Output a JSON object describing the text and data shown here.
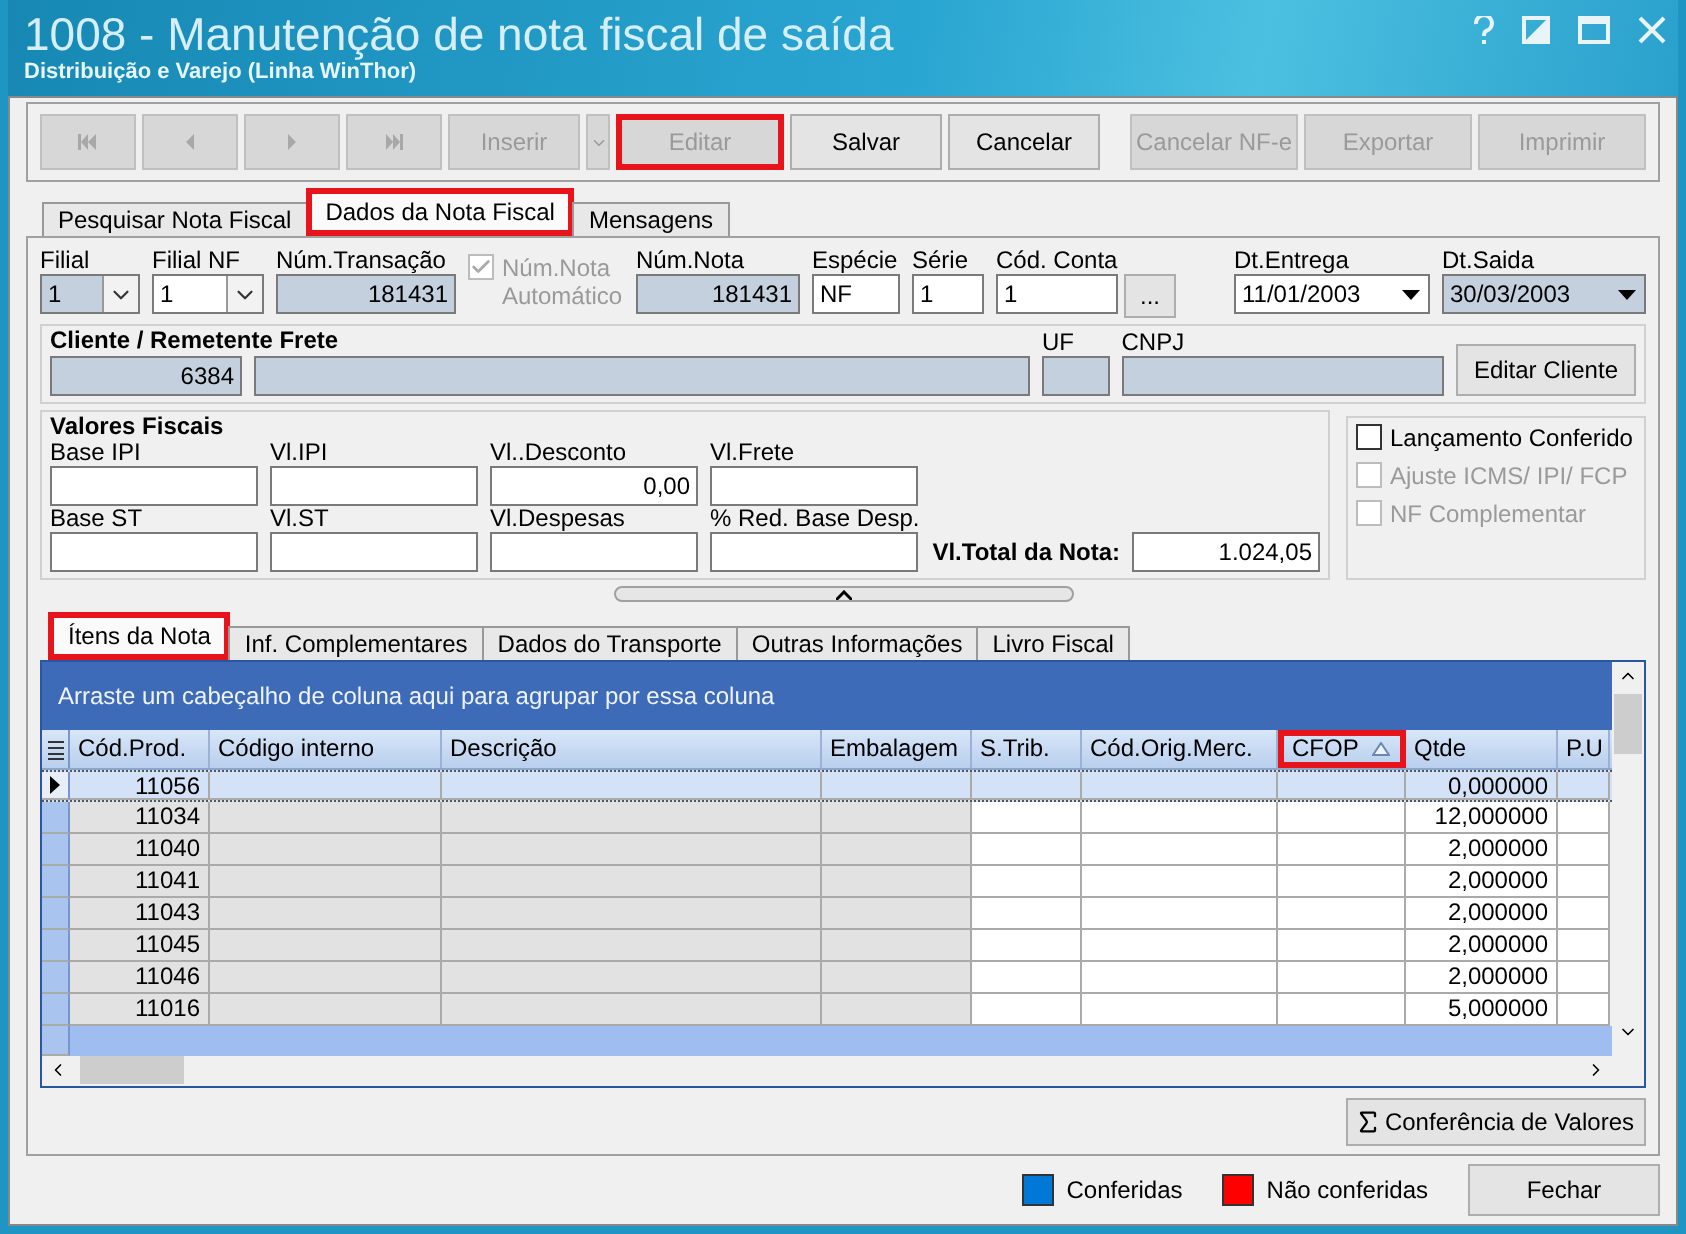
{
  "window": {
    "title": "1008 - Manutenção de nota fiscal de saída",
    "subtitle": "Distribuição e Varejo (Linha WinThor)"
  },
  "toolbar": {
    "buttons": [
      {
        "kind": "first",
        "disabled": true,
        "highlighted": false
      },
      {
        "kind": "prev",
        "disabled": true,
        "highlighted": false
      },
      {
        "kind": "next",
        "disabled": true,
        "highlighted": false
      },
      {
        "kind": "last",
        "disabled": true,
        "highlighted": false
      },
      {
        "kind": "dropdown",
        "label": "Inserir",
        "disabled": true,
        "highlighted": false
      },
      {
        "kind": "text",
        "label": "Editar",
        "disabled": true,
        "highlighted": true
      },
      {
        "kind": "text",
        "label": "Salvar",
        "disabled": false,
        "highlighted": false
      },
      {
        "kind": "text",
        "label": "Cancelar",
        "disabled": false,
        "highlighted": false
      },
      {
        "kind": "text",
        "label": "Cancelar NF-e",
        "disabled": true,
        "highlighted": false
      },
      {
        "kind": "text",
        "label": "Exportar",
        "disabled": true,
        "highlighted": false
      },
      {
        "kind": "text",
        "label": "Imprimir",
        "disabled": true,
        "highlighted": false
      }
    ]
  },
  "tabs": [
    {
      "label": "Pesquisar Nota Fiscal",
      "selected": false,
      "highlighted": false
    },
    {
      "label": "Dados da Nota Fiscal",
      "selected": true,
      "highlighted": true
    },
    {
      "label": "Mensagens",
      "selected": false,
      "highlighted": false
    }
  ],
  "header_fields": [
    {
      "kind": "combo",
      "label": "Filial",
      "value": "1",
      "readonly": true
    },
    {
      "kind": "combo",
      "label": "Filial NF",
      "value": "1",
      "readonly": false
    },
    {
      "kind": "text",
      "label": "Núm.Transação",
      "value": "181431",
      "readonly": true
    },
    {
      "kind": "check",
      "label": "Núm.Nota Automático",
      "checked": true,
      "disabled": true
    },
    {
      "kind": "text",
      "label": "Núm.Nota",
      "value": "181431",
      "readonly": true
    },
    {
      "kind": "text",
      "label": "Espécie",
      "value": "NF",
      "readonly": false
    },
    {
      "kind": "text",
      "label": "Série",
      "value": "1",
      "readonly": false
    },
    {
      "kind": "lookup",
      "label": "Cód. Conta",
      "value": "1",
      "button": "...",
      "readonly": false
    },
    {
      "kind": "date",
      "label": "Dt.Entrega",
      "value": "11/01/2003",
      "readonly": false
    },
    {
      "kind": "date",
      "label": "Dt.Saida",
      "value": "30/03/2003",
      "readonly": true
    }
  ],
  "cliente": {
    "title": "Cliente / Remetente Frete",
    "codigo": "6384",
    "uf_label": "UF",
    "cnpj_label": "CNPJ",
    "button": "Editar Cliente"
  },
  "valores": {
    "title": "Valores Fiscais",
    "fields": [
      {
        "label": "Base IPI"
      },
      {
        "label": "Vl.IPI"
      },
      {
        "label": "Vl..Desconto",
        "value": "0,00"
      },
      {
        "label": "Vl.Frete"
      },
      {
        "label": "Base ST"
      },
      {
        "label": "Vl.ST"
      },
      {
        "label": "Vl.Despesas"
      },
      {
        "label": "% Red. Base Desp."
      }
    ],
    "total_label": "Vl.Total da Nota:",
    "total_value": "1.024,05"
  },
  "checks": [
    {
      "label": "Lançamento Conferido",
      "checked": false,
      "disabled": false
    },
    {
      "label": "Ajuste ICMS/ IPI/ FCP",
      "checked": false,
      "disabled": true
    },
    {
      "label": "NF Complementar",
      "checked": false,
      "disabled": true
    }
  ],
  "subtabs": [
    {
      "label": "Ítens da Nota",
      "selected": true,
      "highlighted": true
    },
    {
      "label": "Inf. Complementares",
      "selected": false,
      "highlighted": false
    },
    {
      "label": "Dados do Transporte",
      "selected": false,
      "highlighted": false
    },
    {
      "label": "Outras Informações",
      "selected": false,
      "highlighted": false
    },
    {
      "label": "Livro Fiscal",
      "selected": false,
      "highlighted": false
    }
  ],
  "grid": {
    "group_hint": "Arraste um cabeçalho de coluna aqui para agrupar por essa coluna",
    "columns": [
      {
        "label": "Cód.Prod.",
        "readonly": true,
        "highlighted": false
      },
      {
        "label": "Código interno",
        "readonly": true,
        "highlighted": false
      },
      {
        "label": "Descrição",
        "readonly": true,
        "highlighted": false
      },
      {
        "label": "Embalagem",
        "readonly": true,
        "highlighted": false
      },
      {
        "label": "S.Trib.",
        "readonly": false,
        "highlighted": false
      },
      {
        "label": "Cód.Orig.Merc.",
        "readonly": false,
        "highlighted": false
      },
      {
        "label": "CFOP",
        "readonly": false,
        "highlighted": true,
        "sorted": true
      },
      {
        "label": "Qtde",
        "readonly": false,
        "highlighted": false
      },
      {
        "label": "P.U",
        "readonly": false,
        "highlighted": false
      }
    ],
    "rows": [
      {
        "cod_prod": "11056",
        "qtde": "0,000000",
        "selected": true
      },
      {
        "cod_prod": "11034",
        "qtde": "12,000000",
        "selected": false
      },
      {
        "cod_prod": "11040",
        "qtde": "2,000000",
        "selected": false
      },
      {
        "cod_prod": "11041",
        "qtde": "2,000000",
        "selected": false
      },
      {
        "cod_prod": "11043",
        "qtde": "2,000000",
        "selected": false
      },
      {
        "cod_prod": "11045",
        "qtde": "2,000000",
        "selected": false
      },
      {
        "cod_prod": "11046",
        "qtde": "2,000000",
        "selected": false
      },
      {
        "cod_prod": "11016",
        "qtde": "5,000000",
        "selected": false
      }
    ]
  },
  "conferencia_button": "Conferência de Valores",
  "legend": [
    {
      "label": "Conferidas",
      "color": "#0078d7"
    },
    {
      "label": "Não conferidas",
      "color": "#ff0000"
    }
  ],
  "close_button": "Fechar"
}
